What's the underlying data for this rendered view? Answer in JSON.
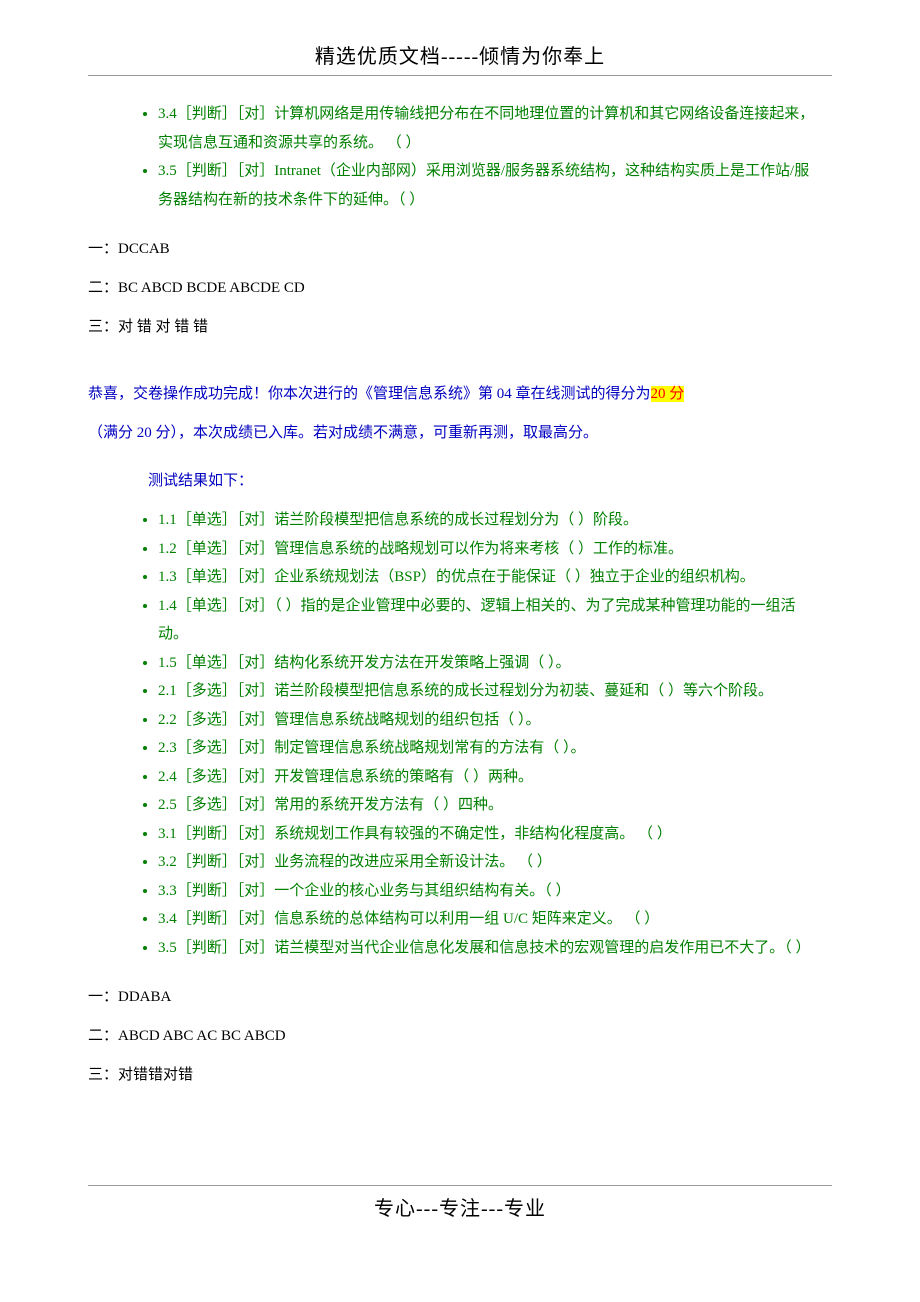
{
  "header": "精选优质文档-----倾情为你奉上",
  "footer": "专心---专注---专业",
  "topList": [
    "3.4［判断］［对］计算机网络是用传输线把分布在不同地理位置的计算机和其它网络设备连接起来，实现信息互通和资源共享的系统。 （ ）",
    "3.5［判断］［对］Intranet（企业内部网）采用浏览器/服务器系统结构，这种结构实质上是工作站/服务器结构在新的技术条件下的延伸。（ ）"
  ],
  "answers1": {
    "line1": "一：DCCAB",
    "line2": "二：BC   ABCD BCDE ABCDE CD",
    "line3": "三：对 错 对 错 错"
  },
  "congrats": {
    "part1": "恭喜，交卷操作成功完成！你本次进行的《管理信息系统》第 04 章在线测试的得分为",
    "score": "20 分",
    "part2": "（满分 20 分），本次成绩已入库。若对成绩不满意，可重新再测，取最高分。"
  },
  "resultLabel": "测试结果如下：",
  "bottomList": [
    "1.1［单选］［对］诺兰阶段模型把信息系统的成长过程划分为（ ）阶段。",
    "1.2［单选］［对］管理信息系统的战略规划可以作为将来考核（ ）工作的标准。",
    "1.3［单选］［对］企业系统规划法（BSP）的优点在于能保证（ ）独立于企业的组织机构。",
    "1.4［单选］［对］（ ）指的是企业管理中必要的、逻辑上相关的、为了完成某种管理功能的一组活动。",
    "1.5［单选］［对］结构化系统开发方法在开发策略上强调（ ）。",
    "2.1［多选］［对］诺兰阶段模型把信息系统的成长过程划分为初装、蔓延和（ ）等六个阶段。",
    "2.2［多选］［对］管理信息系统战略规划的组织包括（ ）。",
    "2.3［多选］［对］制定管理信息系统战略规划常有的方法有（ ）。",
    "2.4［多选］［对］开发管理信息系统的策略有（ ）两种。",
    "2.5［多选］［对］常用的系统开发方法有（ ）四种。",
    "3.1［判断］［对］系统规划工作具有较强的不确定性，非结构化程度高。 （ ）",
    "3.2［判断］［对］业务流程的改进应采用全新设计法。 （ ）",
    "3.3［判断］［对］一个企业的核心业务与其组织结构有关。（ ）",
    "3.4［判断］［对］信息系统的总体结构可以利用一组 U/C 矩阵来定义。 （ ）",
    "3.5［判断］［对］诺兰模型对当代企业信息化发展和信息技术的宏观管理的启发作用已不大了。（ ）"
  ],
  "answers2": {
    "line1": "一：DDABA",
    "line2": "二：ABCD ABC AC BC ABCD",
    "line3": "三：对错错对错"
  }
}
